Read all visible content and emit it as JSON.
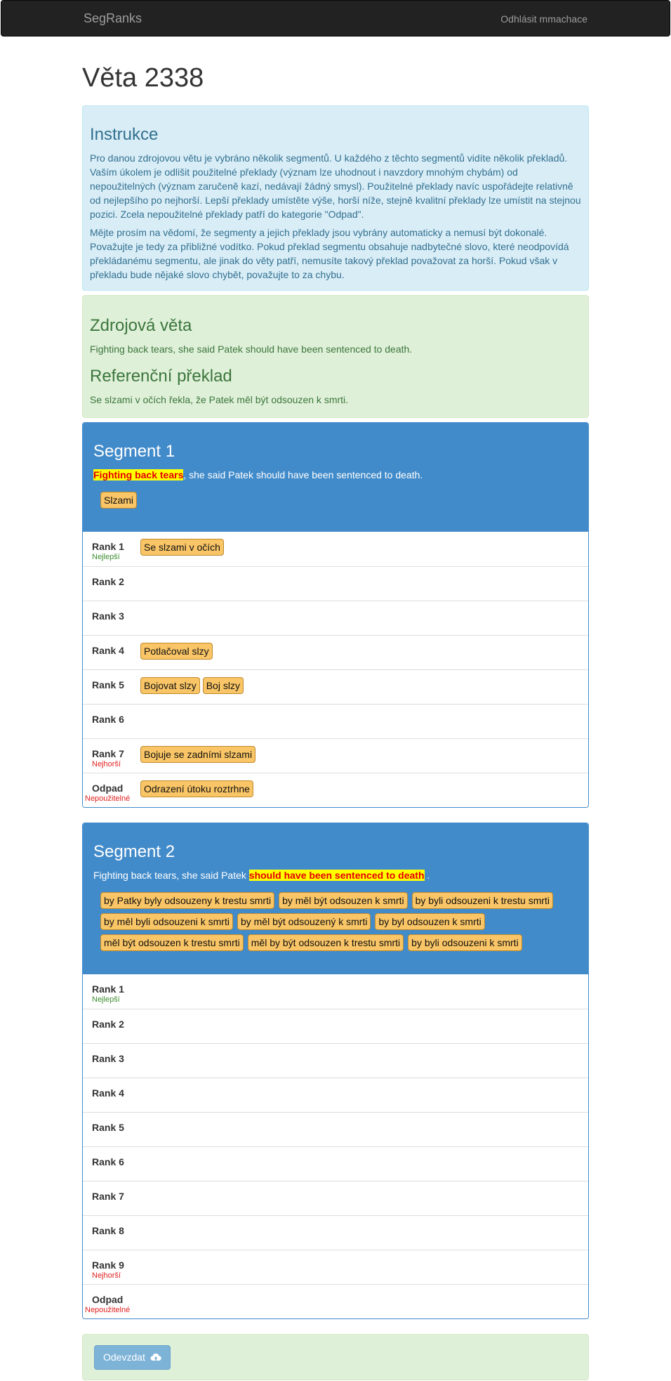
{
  "nav": {
    "brand": "SegRanks",
    "logout": "Odhlásit mmachace"
  },
  "page": {
    "title": "Věta 2338"
  },
  "instructions": {
    "heading": "Instrukce",
    "p1": "Pro danou zdrojovou větu je vybráno několik segmentů. U každého z těchto segmentů vidíte několik překladů. Vaším úkolem je odlišit použitelné překlady (význam lze uhodnout i navzdory mnohým chybám) od nepoužitelných (význam zaručeně kazí, nedávají žádný smysl). Použitelné překlady navíc uspořádejte relativně od nejlepšího po nejhorší. Lepší překlady umístěte výše, horší níže, stejně kvalitní překlady lze umístit na stejnou pozici. Zcela nepoužitelné překlady patří do kategorie \"Odpad\".",
    "p2": "Mějte prosím na vědomí, že segmenty a jejich překlady jsou vybrány automaticky a nemusí být dokonalé. Považujte je tedy za přibližné vodítko. Pokud překlad segmentu obsahuje nadbytečné slovo, které neodpovídá překládanému segmentu, ale jinak do věty patří, nemusíte takový překlad považovat za horší. Pokud však v překladu bude nějaké slovo chybět, považujte to za chybu."
  },
  "source": {
    "heading": "Zdrojová věta",
    "text": "Fighting back tears, she said Patek should have been sentenced to death.",
    "ref_heading": "Referenční překlad",
    "ref_text": "Se slzami v očích řekla, že Patek měl být odsouzen k smrti."
  },
  "segment1": {
    "title": "Segment 1",
    "highlight": "Fighting back tears",
    "rest": ", she said Patek should have been sentenced to death.",
    "pool": [
      "Slzami"
    ],
    "ranks": [
      {
        "label": "Rank 1",
        "sub": "Nejlepší",
        "chips": [
          "Se slzami v očích"
        ]
      },
      {
        "label": "Rank 2",
        "sub": "",
        "chips": []
      },
      {
        "label": "Rank 3",
        "sub": "",
        "chips": []
      },
      {
        "label": "Rank 4",
        "sub": "",
        "chips": [
          "Potlačoval slzy"
        ]
      },
      {
        "label": "Rank 5",
        "sub": "",
        "chips": [
          "Bojovat slzy",
          "Boj slzy"
        ]
      },
      {
        "label": "Rank 6",
        "sub": "",
        "chips": []
      },
      {
        "label": "Rank 7",
        "sub": "Nejhorší",
        "chips": [
          "Bojuje se zadními slzami"
        ]
      },
      {
        "label": "Odpad",
        "sub": "Nepoužitelné",
        "chips": [
          "Odrazení útoku roztrhne"
        ]
      }
    ]
  },
  "segment2": {
    "title": "Segment 2",
    "before": "Fighting back tears, she said Patek ",
    "highlight": "should have been sentenced to death",
    "after": " .",
    "pool": [
      "by Patky byly odsouzeny k trestu smrti",
      "by měl být odsouzen k smrti",
      "by byli odsouzeni k trestu smrti",
      "by měl byli odsouzeni k smrti",
      "by měl být odsouzený k smrti",
      "by byl odsouzen k smrti",
      "měl být odsouzen k trestu smrti",
      "měl by být odsouzen k trestu smrti",
      "by byli odsouzeni k smrti"
    ],
    "ranks": [
      {
        "label": "Rank 1",
        "sub": "Nejlepší"
      },
      {
        "label": "Rank 2",
        "sub": ""
      },
      {
        "label": "Rank 3",
        "sub": ""
      },
      {
        "label": "Rank 4",
        "sub": ""
      },
      {
        "label": "Rank 5",
        "sub": ""
      },
      {
        "label": "Rank 6",
        "sub": ""
      },
      {
        "label": "Rank 7",
        "sub": ""
      },
      {
        "label": "Rank 8",
        "sub": ""
      },
      {
        "label": "Rank 9",
        "sub": "Nejhorší"
      },
      {
        "label": "Odpad",
        "sub": "Nepoužitelné"
      }
    ]
  },
  "submit": {
    "label": "Odevzdat",
    "icon": "cloud-upload-icon"
  }
}
